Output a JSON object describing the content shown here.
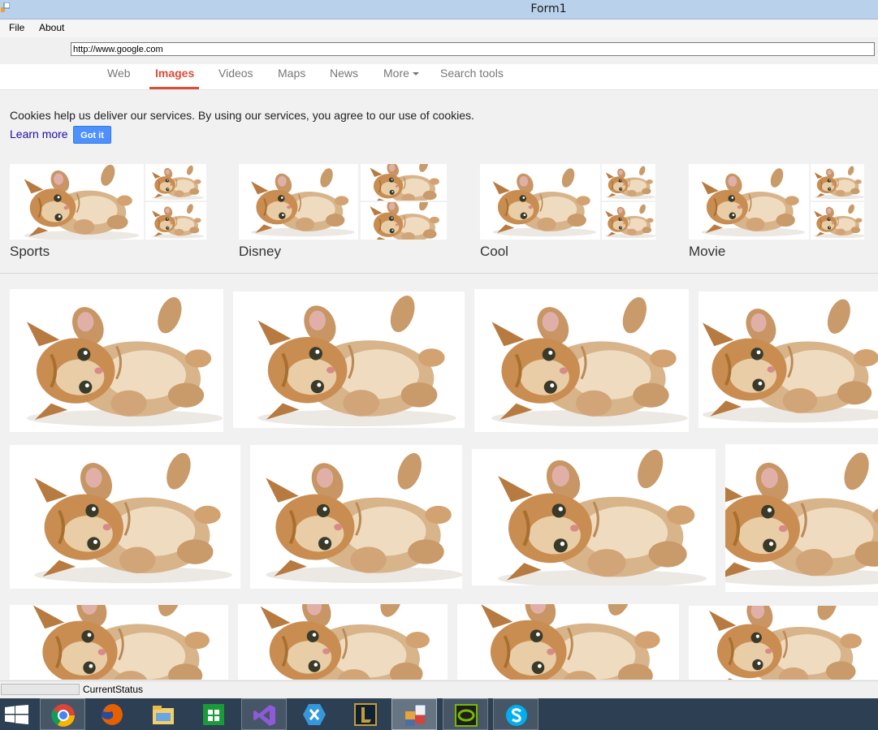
{
  "window": {
    "title": "Form1"
  },
  "menu": {
    "file": "File",
    "about": "About"
  },
  "address": {
    "url": "http://www.google.com"
  },
  "tabs": [
    {
      "label": "Web"
    },
    {
      "label": "Images"
    },
    {
      "label": "Videos"
    },
    {
      "label": "Maps"
    },
    {
      "label": "News"
    },
    {
      "label": "More"
    },
    {
      "label": "Search tools"
    }
  ],
  "cookie": {
    "message": "Cookies help us deliver our services. By using our services, you agree to our use of cookies.",
    "learn_more": "Learn more",
    "got_it": "Got it"
  },
  "categories": [
    {
      "label": "Sports"
    },
    {
      "label": "Disney"
    },
    {
      "label": "Cool"
    },
    {
      "label": "Movie"
    }
  ],
  "status": {
    "text": "CurrentStatus"
  },
  "taskbar": {
    "items": [
      "start-icon",
      "chrome-icon",
      "firefox-icon",
      "file-explorer-icon",
      "store-icon",
      "visual-studio-icon",
      "xamarin-icon",
      "league-of-legends-icon",
      "form-app-icon",
      "nvidia-icon",
      "skype-icon"
    ]
  },
  "colors": {
    "accent": "#dd4b39",
    "button": "#4d90fe",
    "link": "#1a0dab",
    "taskbar": "#2d3f52",
    "titlebar": "#b9d1ea"
  }
}
